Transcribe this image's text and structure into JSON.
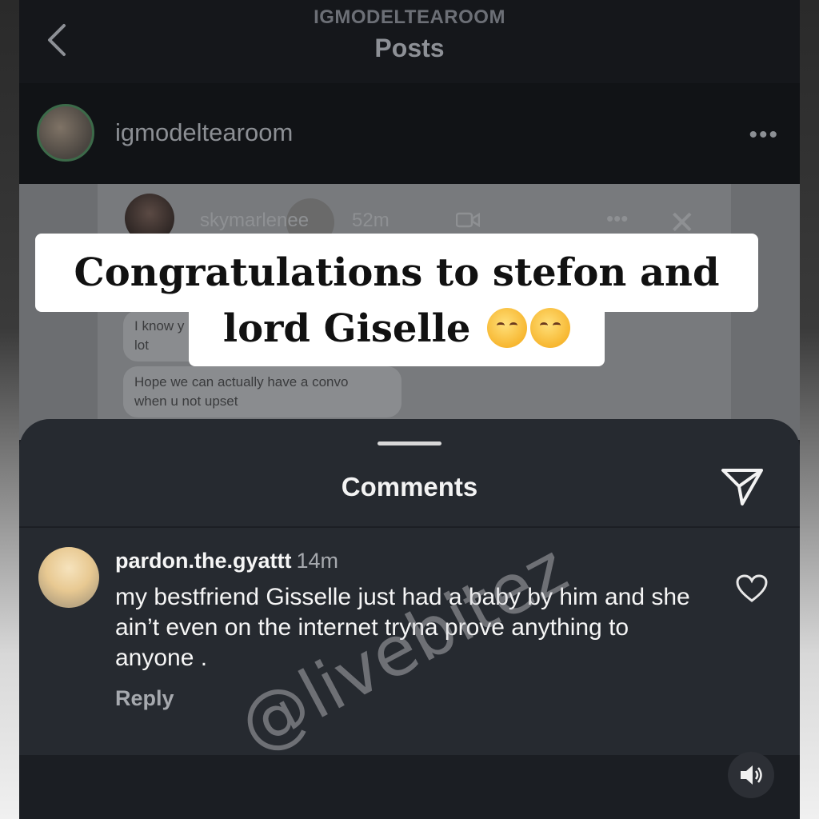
{
  "nav": {
    "account": "IGMODELTEAROOM",
    "title": "Posts"
  },
  "post": {
    "username": "igmodeltearoom",
    "more": "•••"
  },
  "dm_preview": {
    "username": "skymarlenee",
    "time": "52m",
    "more": "•••",
    "close": "✕",
    "bubble1_line1": "I know y",
    "bubble1_line2": "lot",
    "bubble2_line1": "Hope we can actually have a convo",
    "bubble2_line2": "when u not upset"
  },
  "overlay": {
    "line1": "Congratulations to stefon and",
    "line2": "lord Giselle"
  },
  "comments": {
    "title": "Comments",
    "items": [
      {
        "username": "pardon.the.gyattt",
        "time": "14m",
        "text": "my bestfriend Gisselle just had a baby by him and she ain’t even on the internet tryna prove anything to anyone .",
        "reply": "Reply"
      }
    ]
  },
  "watermark": "@livebitez",
  "icons": {
    "back": "chevron-left-icon",
    "send": "send-icon",
    "like": "heart-icon",
    "sound": "speaker-icon",
    "video": "video-icon"
  },
  "colors": {
    "sheet_background": "#262a30",
    "overlay_banner": "#ffffff",
    "nav_background": "#15171b"
  }
}
